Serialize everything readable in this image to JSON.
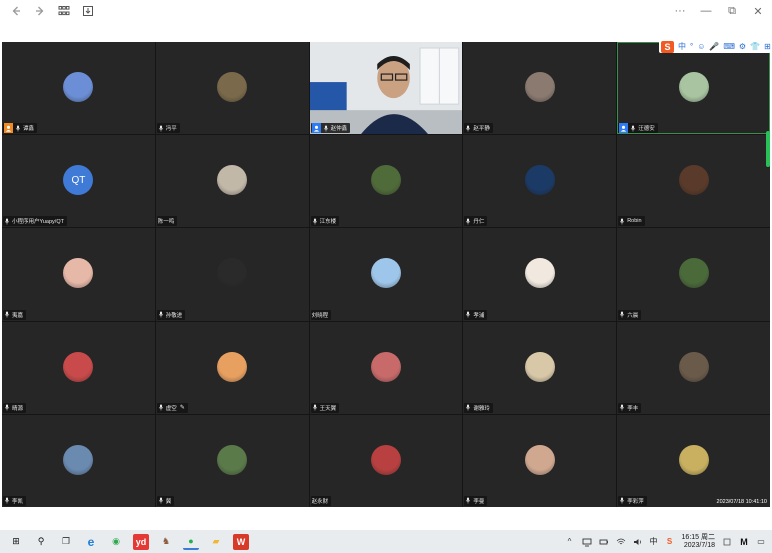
{
  "titlebar": {
    "back_icon": "arrow-left-icon",
    "forward_icon": "arrow-right-icon",
    "grid_icon": "grid-view-icon",
    "download_icon": "download-icon",
    "more_label": "···",
    "minimize_label": "—",
    "restore_label": "⧉",
    "close_label": "✕"
  },
  "ime": {
    "logo": "S",
    "lang": "中",
    "items": [
      "°",
      "☺",
      "🎤",
      "⌨",
      "⚙",
      "👕",
      "⊞"
    ]
  },
  "participants": [
    {
      "name": "谭鑫",
      "avatar_color": "#6b8ed6",
      "host": "orange",
      "mic": true
    },
    {
      "name": "冯平",
      "avatar_color": "#7a6a4b",
      "host": null,
      "mic": true
    },
    {
      "name": "赵仲鑫",
      "avatar_color": null,
      "host": "blue",
      "mic": true,
      "video": true
    },
    {
      "name": "赵平静",
      "avatar_color": "#8a7a70",
      "host": null,
      "mic": true
    },
    {
      "name": "汪德安",
      "avatar_color": "#a8c4a0",
      "host": "blue",
      "mic": true,
      "selected": true
    },
    {
      "name": "小程序用户Yuapy/QT",
      "avatar_color": "#3f7ad6",
      "initials": "QT",
      "host": null,
      "mic": true
    },
    {
      "name": "陈一鸣",
      "avatar_color": "#c2b8a8",
      "host": null,
      "mic": false
    },
    {
      "name": "江东楼",
      "avatar_color": "#4f6b3a",
      "host": null,
      "mic": true
    },
    {
      "name": "丹仁",
      "avatar_color": "#1b3a66",
      "host": null,
      "mic": true
    },
    {
      "name": "Robin",
      "avatar_color": "#5a3a2a",
      "host": null,
      "mic": true
    },
    {
      "name": "夷嘉",
      "avatar_color": "#e6b8a8",
      "host": null,
      "mic": true
    },
    {
      "name": "孙敬进",
      "avatar_color": "#2a2a2a",
      "host": null,
      "mic": true
    },
    {
      "name": "刘晓程",
      "avatar_color": "#9ec6ea",
      "host": null,
      "mic": false
    },
    {
      "name": "孝浦",
      "avatar_color": "#f1e9e0",
      "host": null,
      "mic": true
    },
    {
      "name": "六晨",
      "avatar_color": "#4a6a3a",
      "host": null,
      "mic": true
    },
    {
      "name": "晴源",
      "avatar_color": "#c84a4a",
      "host": null,
      "mic": true
    },
    {
      "name": "虚空",
      "avatar_color": "#e8a060",
      "host": null,
      "mic": true,
      "pen": true
    },
    {
      "name": "王天翼",
      "avatar_color": "#c86a6a",
      "host": null,
      "mic": true
    },
    {
      "name": "谢雅玲",
      "avatar_color": "#d8c8a8",
      "host": null,
      "mic": true
    },
    {
      "name": "李丰",
      "avatar_color": "#6a5a4a",
      "host": null,
      "mic": true
    },
    {
      "name": "李凯",
      "avatar_color": "#6a8ab0",
      "host": null,
      "mic": true
    },
    {
      "name": "冀",
      "avatar_color": "#5a7a4a",
      "host": null,
      "mic": true
    },
    {
      "name": "赵永财",
      "avatar_color": "#b84040",
      "host": null,
      "mic": false
    },
    {
      "name": "李曼",
      "avatar_color": "#d0a890",
      "host": null,
      "mic": true
    },
    {
      "name": "李彩萍",
      "avatar_color": "#c8b060",
      "host": null,
      "mic": true
    }
  ],
  "timestamp": "2023/07/18 10:41:10",
  "taskbar": {
    "apps": [
      {
        "name": "windows-start-icon",
        "glyph": "⊞",
        "color": "#111111"
      },
      {
        "name": "search-icon",
        "glyph": "⚲",
        "color": "#111111"
      },
      {
        "name": "task-view-icon",
        "glyph": "❐",
        "color": "#333333"
      },
      {
        "name": "edge-browser-icon",
        "glyph": "e",
        "color": "#1e7fd6"
      },
      {
        "name": "green-app-icon",
        "glyph": "◉",
        "color": "#2fa84f"
      },
      {
        "name": "youdao-icon",
        "glyph": "yd",
        "color": "#e53935"
      },
      {
        "name": "game-app-icon",
        "glyph": "♞",
        "color": "#8a5a3a"
      },
      {
        "name": "wechat-icon",
        "glyph": "●",
        "color": "#21b04b",
        "active": true
      },
      {
        "name": "file-explorer-icon",
        "glyph": "▰",
        "color": "#f2b634"
      },
      {
        "name": "wps-icon",
        "glyph": "W",
        "color": "#d83a2a"
      }
    ],
    "tray": {
      "chevron": "^",
      "ime_lang": "中",
      "sogou": "S",
      "time": "16:15 周二",
      "date": "2023/7/18",
      "notification_glyph": "▭"
    }
  }
}
